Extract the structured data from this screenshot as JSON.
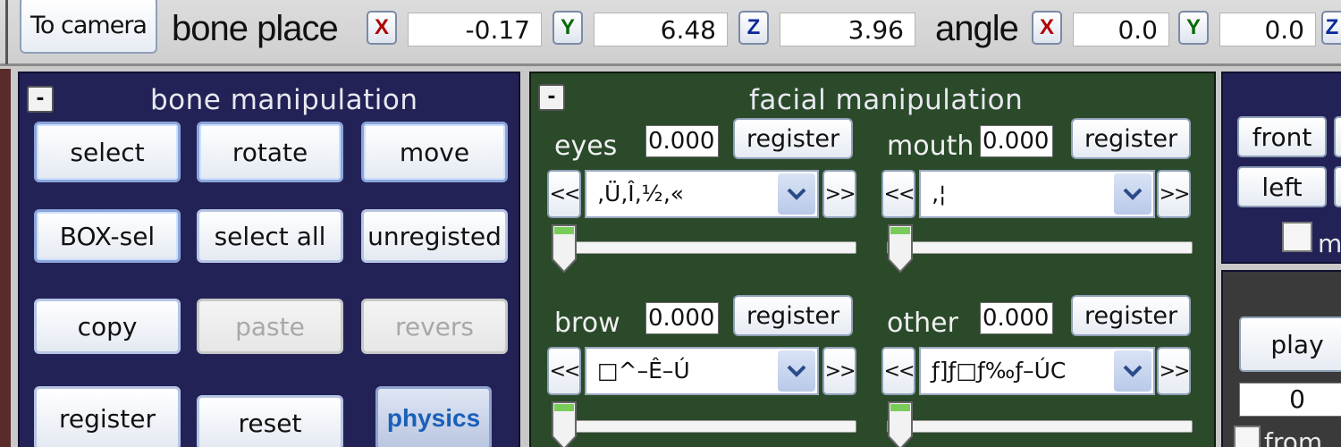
{
  "toolbar": {
    "to_camera_label": "To camera",
    "bone_place_label": "bone place",
    "bone_place": {
      "x_label": "X",
      "x": "-0.17",
      "y_label": "Y",
      "y": "6.48",
      "z_label": "Z",
      "z": "3.96"
    },
    "angle_label": "angle",
    "angle": {
      "x_label": "X",
      "x": "0.0",
      "y_label": "Y",
      "y": "0.0",
      "z_label": "Z"
    }
  },
  "bone_panel": {
    "collapse_label": "-",
    "title": "bone manipulation",
    "buttons": {
      "select": "select",
      "rotate": "rotate",
      "move": "move",
      "box_sel": "BOX-sel",
      "select_all": "select all",
      "unregisted": "unregisted",
      "copy": "copy",
      "paste": "paste",
      "revers": "revers",
      "register": "register",
      "reset": "reset",
      "physics": "physics"
    }
  },
  "face_panel": {
    "collapse_label": "-",
    "title": "facial manipulation",
    "nav_prev": "<<",
    "nav_next": ">>",
    "groups": {
      "eyes": {
        "label": "eyes",
        "value": "0.000",
        "register": "register",
        "selected": "‚Ü‚Î‚½‚«"
      },
      "mouth": {
        "label": "mouth",
        "value": "0.000",
        "register": "register",
        "selected": "‚¦"
      },
      "brow": {
        "label": "brow",
        "value": "0.000",
        "register": "register",
        "selected": "□^–Ê–Ú"
      },
      "other": {
        "label": "other",
        "value": "0.000",
        "register": "register",
        "selected": "ƒ]ƒ□ƒ‰ƒ–ÚC"
      }
    }
  },
  "right_panel": {
    "front": "front",
    "left": "left",
    "checkbox_label": "m",
    "play": "play",
    "frame_value": "0",
    "from_label": "from"
  }
}
